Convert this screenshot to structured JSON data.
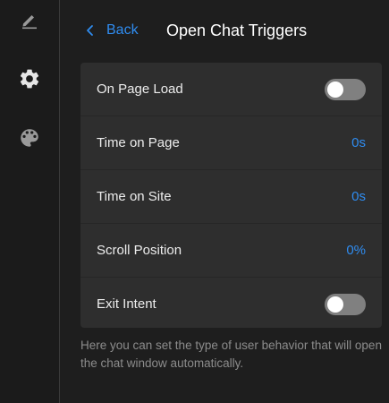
{
  "rail": {
    "items": [
      {
        "icon": "pencil-icon"
      },
      {
        "icon": "gear-icon"
      },
      {
        "icon": "palette-icon"
      }
    ]
  },
  "header": {
    "back_label": "Back",
    "title": "Open Chat Triggers"
  },
  "triggers": [
    {
      "label": "On Page Load",
      "type": "toggle",
      "on": false
    },
    {
      "label": "Time on Page",
      "type": "value",
      "value": "0s"
    },
    {
      "label": "Time on Site",
      "type": "value",
      "value": "0s"
    },
    {
      "label": "Scroll Position",
      "type": "value",
      "value": "0%"
    },
    {
      "label": "Exit Intent",
      "type": "toggle",
      "on": false
    }
  ],
  "helper_text": "Here you can set the type of user behavior that will open the chat window automatically.",
  "colors": {
    "accent": "#2f8cf0",
    "background": "#1e1e1e",
    "card": "#2e2e2e",
    "toggle_off": "#808080"
  }
}
